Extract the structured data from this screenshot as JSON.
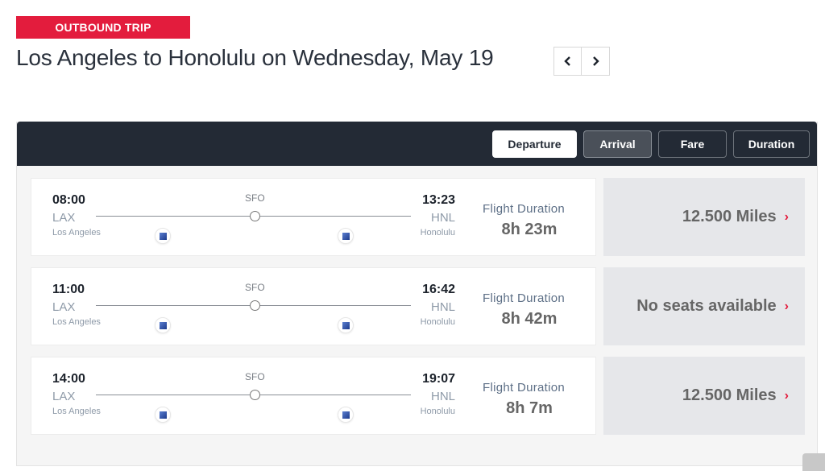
{
  "header": {
    "badge": "OUTBOUND TRIP",
    "title": "Los Angeles to Honolulu on Wednesday, May 19",
    "prev_day_icon": "chevron-left-icon",
    "next_day_icon": "chevron-right-icon"
  },
  "sort": {
    "buttons": [
      {
        "label": "Departure",
        "state": "selected"
      },
      {
        "label": "Arrival",
        "state": "hover"
      },
      {
        "label": "Fare",
        "state": "default"
      },
      {
        "label": "Duration",
        "state": "default"
      }
    ]
  },
  "flights": [
    {
      "departure_time": "08:00",
      "departure_code": "LAX",
      "departure_city": "Los Angeles",
      "stop_code": "SFO",
      "arrival_time": "13:23",
      "arrival_code": "HNL",
      "arrival_city": "Honolulu",
      "duration_label": "Flight Duration",
      "duration": "8h 23m",
      "price": "12.500 Miles"
    },
    {
      "departure_time": "11:00",
      "departure_code": "LAX",
      "departure_city": "Los Angeles",
      "stop_code": "SFO",
      "arrival_time": "16:42",
      "arrival_code": "HNL",
      "arrival_city": "Honolulu",
      "duration_label": "Flight Duration",
      "duration": "8h 42m",
      "price": "No seats available"
    },
    {
      "departure_time": "14:00",
      "departure_code": "LAX",
      "departure_city": "Los Angeles",
      "stop_code": "SFO",
      "arrival_time": "19:07",
      "arrival_code": "HNL",
      "arrival_city": "Honolulu",
      "duration_label": "Flight Duration",
      "duration": "8h 7m",
      "price": "12.500 Miles"
    }
  ],
  "colors": {
    "accent_red": "#e31c3d",
    "sort_bar": "#232a35",
    "price_bg": "#e6e7ea"
  }
}
